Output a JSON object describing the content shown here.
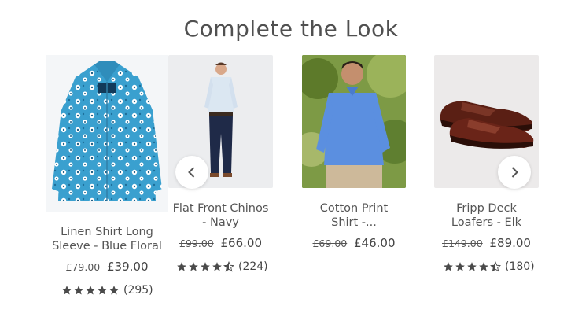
{
  "section_title": "Complete the Look",
  "products": [
    {
      "name_line1": "Linen Shirt Long",
      "name_line2": "Sleeve - Blue Floral",
      "old_price": "£79.00",
      "price": "£39.00",
      "rating": 5,
      "reviews": "(295)",
      "image": "blue-floral-shirt-image"
    },
    {
      "name_line1": "Flat Front Chinos",
      "name_line2": "- Navy",
      "old_price": "£99.00",
      "price": "£66.00",
      "rating": 4.5,
      "reviews": "(224)",
      "image": "navy-chinos-model-image"
    },
    {
      "name_line1": "Cotton Print",
      "name_line2": "Shirt -...",
      "old_price": "£69.00",
      "price": "£46.00",
      "image": "cotton-print-shirt-model-image"
    },
    {
      "name_line1": "Fripp Deck",
      "name_line2": "Loafers - Elk",
      "old_price": "£149.00",
      "price": "£89.00",
      "rating": 4.5,
      "reviews": "(180)",
      "image": "deck-loafers-image"
    }
  ],
  "carousel": {
    "prev_icon": "chevron-left-icon",
    "next_icon": "chevron-right-icon"
  },
  "colors": {
    "star": "#4a4a4a",
    "shirt_blue": "#3a9cc9",
    "shoe_brown": "#5a1f14"
  }
}
